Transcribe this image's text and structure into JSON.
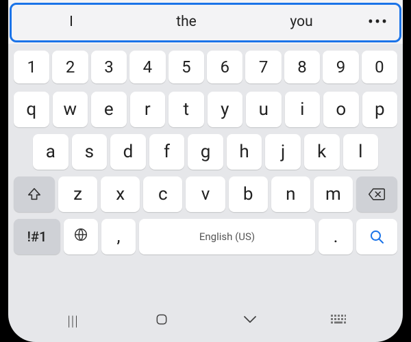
{
  "suggestions": [
    "I",
    "the",
    "you"
  ],
  "more_label": "•••",
  "rows": {
    "numbers": [
      "1",
      "2",
      "3",
      "4",
      "5",
      "6",
      "7",
      "8",
      "9",
      "0"
    ],
    "top": [
      "q",
      "w",
      "e",
      "r",
      "t",
      "y",
      "u",
      "i",
      "o",
      "p"
    ],
    "mid": [
      "a",
      "s",
      "d",
      "f",
      "g",
      "h",
      "j",
      "k",
      "l"
    ],
    "bot": [
      "z",
      "x",
      "c",
      "v",
      "b",
      "n",
      "m"
    ]
  },
  "symbol_key": "!#1",
  "comma": ",",
  "period": ".",
  "space_label": "English (US)",
  "nav": {
    "recents": "|||"
  }
}
